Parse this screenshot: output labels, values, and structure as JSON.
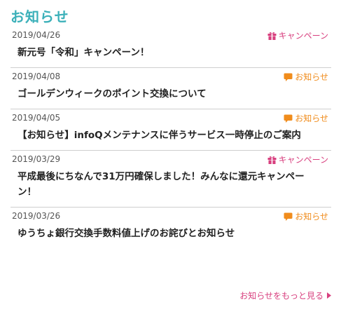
{
  "page": {
    "title": "お知らせ"
  },
  "colors": {
    "title": "#3bb0b9",
    "campaign": "#d8407f",
    "info": "#f08c1c"
  },
  "news": [
    {
      "date": "2019/04/26",
      "category": "キャンペーン",
      "icon": "gift-icon",
      "title": "新元号「令和」キャンペーン！"
    },
    {
      "date": "2019/04/08",
      "category": "お知らせ",
      "icon": "speech-bubble-icon",
      "title": "ゴールデンウィークのポイント交換について"
    },
    {
      "date": "2019/04/05",
      "category": "お知らせ",
      "icon": "speech-bubble-icon",
      "title": "【お知らせ】infoQメンテナンスに伴うサービス一時停止のご案内"
    },
    {
      "date": "2019/03/29",
      "category": "キャンペーン",
      "icon": "gift-icon",
      "title": "平成最後にちなんで31万円確保しました！みんなに還元キャンペーン！"
    },
    {
      "date": "2019/03/26",
      "category": "お知らせ",
      "icon": "speech-bubble-icon",
      "title": "ゆうちょ銀行交換手数料値上げのお詫びとお知らせ"
    }
  ],
  "more_link": {
    "label": "お知らせをもっと見る",
    "icon": "caret-right-icon"
  }
}
